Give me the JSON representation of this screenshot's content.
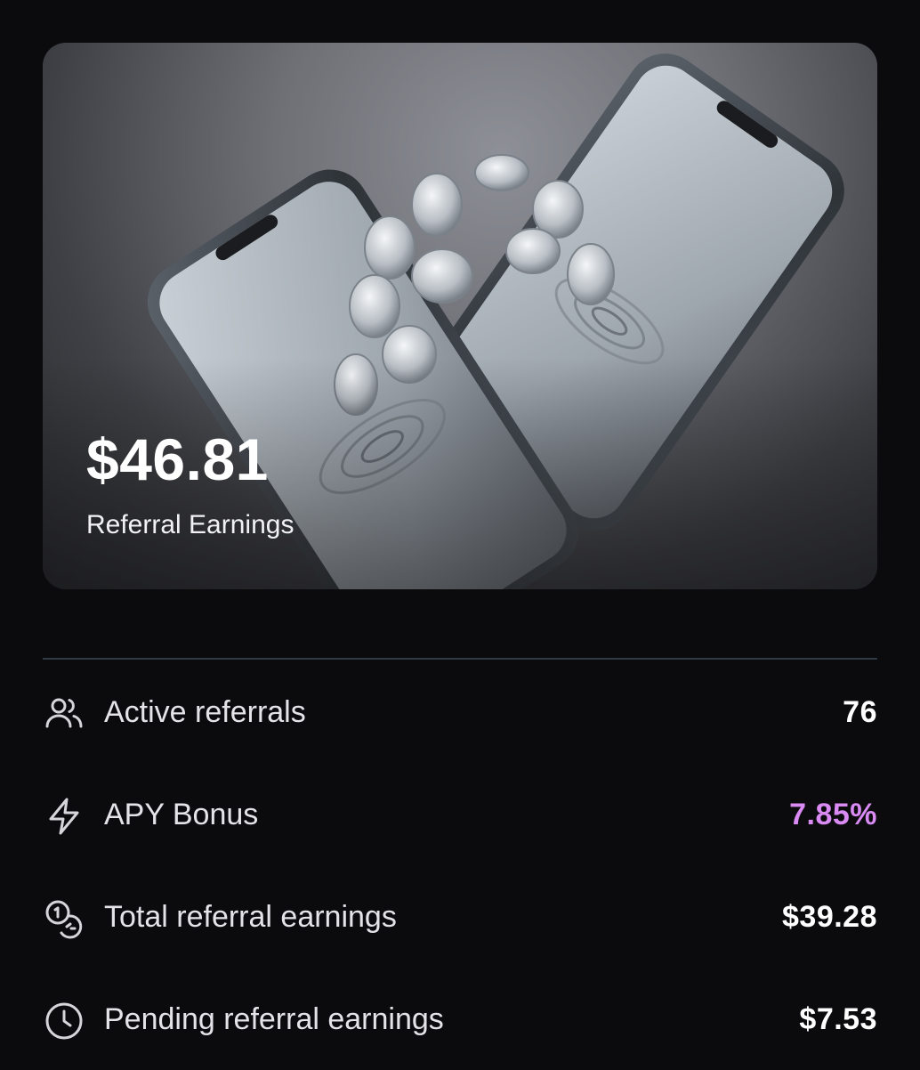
{
  "hero": {
    "amount": "$46.81",
    "label": "Referral Earnings",
    "image": "two-phones-with-coins"
  },
  "stats": [
    {
      "icon": "users-icon",
      "label": "Active referrals",
      "value": "76",
      "value_color": "#ffffff"
    },
    {
      "icon": "lightning-icon",
      "label": "APY Bonus",
      "value": "7.85%",
      "value_color": "#d98af3"
    },
    {
      "icon": "coins-icon",
      "label": "Total referral earnings",
      "value": "$39.28",
      "value_color": "#ffffff"
    },
    {
      "icon": "clock-icon",
      "label": "Pending referral earnings",
      "value": "$7.53",
      "value_color": "#ffffff"
    }
  ],
  "colors": {
    "background": "#0b0b0e",
    "divider": "#2f3a44",
    "accent": "#d98af3"
  }
}
